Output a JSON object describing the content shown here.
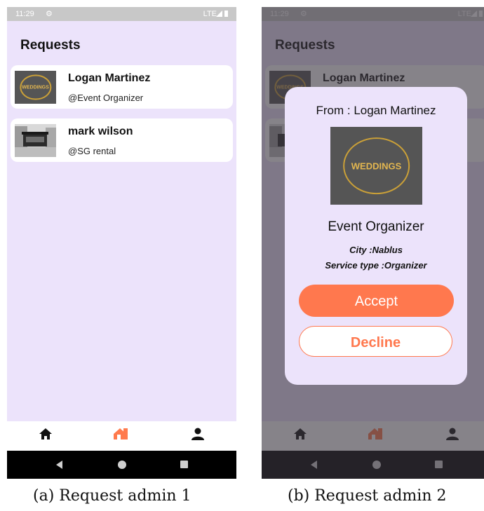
{
  "status_bar": {
    "time": "11:29",
    "network": "LTE"
  },
  "screen": {
    "title": "Requests"
  },
  "requests": [
    {
      "name": "Logan Martinez",
      "role": "@Event Organizer",
      "thumb_text": "WEDDINGS"
    },
    {
      "name": "mark wilson",
      "role": "@SG rental"
    }
  ],
  "bottom_nav": {
    "items": [
      "home-icon",
      "requests-icon",
      "profile-icon"
    ],
    "active_color": "#ff7a4d"
  },
  "dialog": {
    "from": "From : Logan Martinez",
    "image_text": "WEDDINGS",
    "role": "Event Organizer",
    "city": "City :Nablus",
    "service": "Service type :Organizer",
    "accept_label": "Accept",
    "decline_label": "Decline"
  },
  "captions": {
    "a": "(a) Request admin 1",
    "b": "(b) Request admin 2"
  },
  "colors": {
    "background": "#ece3fb",
    "accent": "#ff784e",
    "card": "#ffffff"
  }
}
